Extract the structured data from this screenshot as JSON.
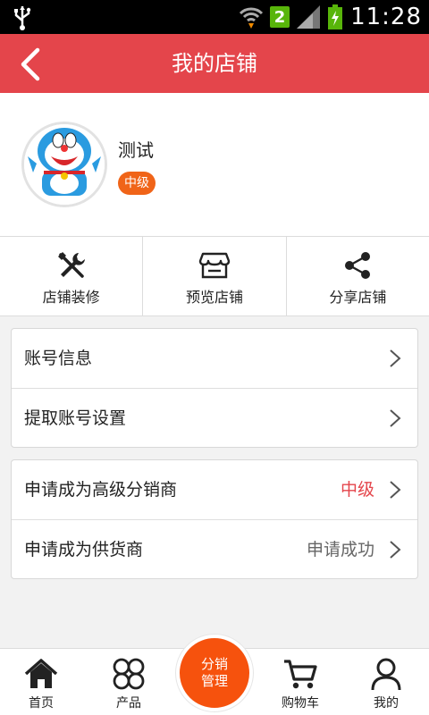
{
  "status_bar": {
    "time": "11:28",
    "sim_slot": "2"
  },
  "header": {
    "title": "我的店铺"
  },
  "profile": {
    "name": "测试",
    "level": "中级"
  },
  "actions": [
    {
      "label": "店铺装修",
      "icon": "tools-icon"
    },
    {
      "label": "预览店铺",
      "icon": "store-icon"
    },
    {
      "label": "分享店铺",
      "icon": "share-icon"
    }
  ],
  "menu_group_1": [
    {
      "label": "账号信息"
    },
    {
      "label": "提取账号设置"
    }
  ],
  "menu_group_2": [
    {
      "label": "申请成为高级分销商",
      "value": "中级",
      "value_color": "#e4454b"
    },
    {
      "label": "申请成为供货商",
      "value": "申请成功",
      "value_color": "#666666"
    }
  ],
  "bottom_nav": {
    "home": "首页",
    "products": "产品",
    "center_line1": "分销",
    "center_line2": "管理",
    "cart": "购物车",
    "mine": "我的"
  },
  "colors": {
    "accent": "#e4454b",
    "orange": "#f6520d",
    "badge": "#f06418"
  }
}
